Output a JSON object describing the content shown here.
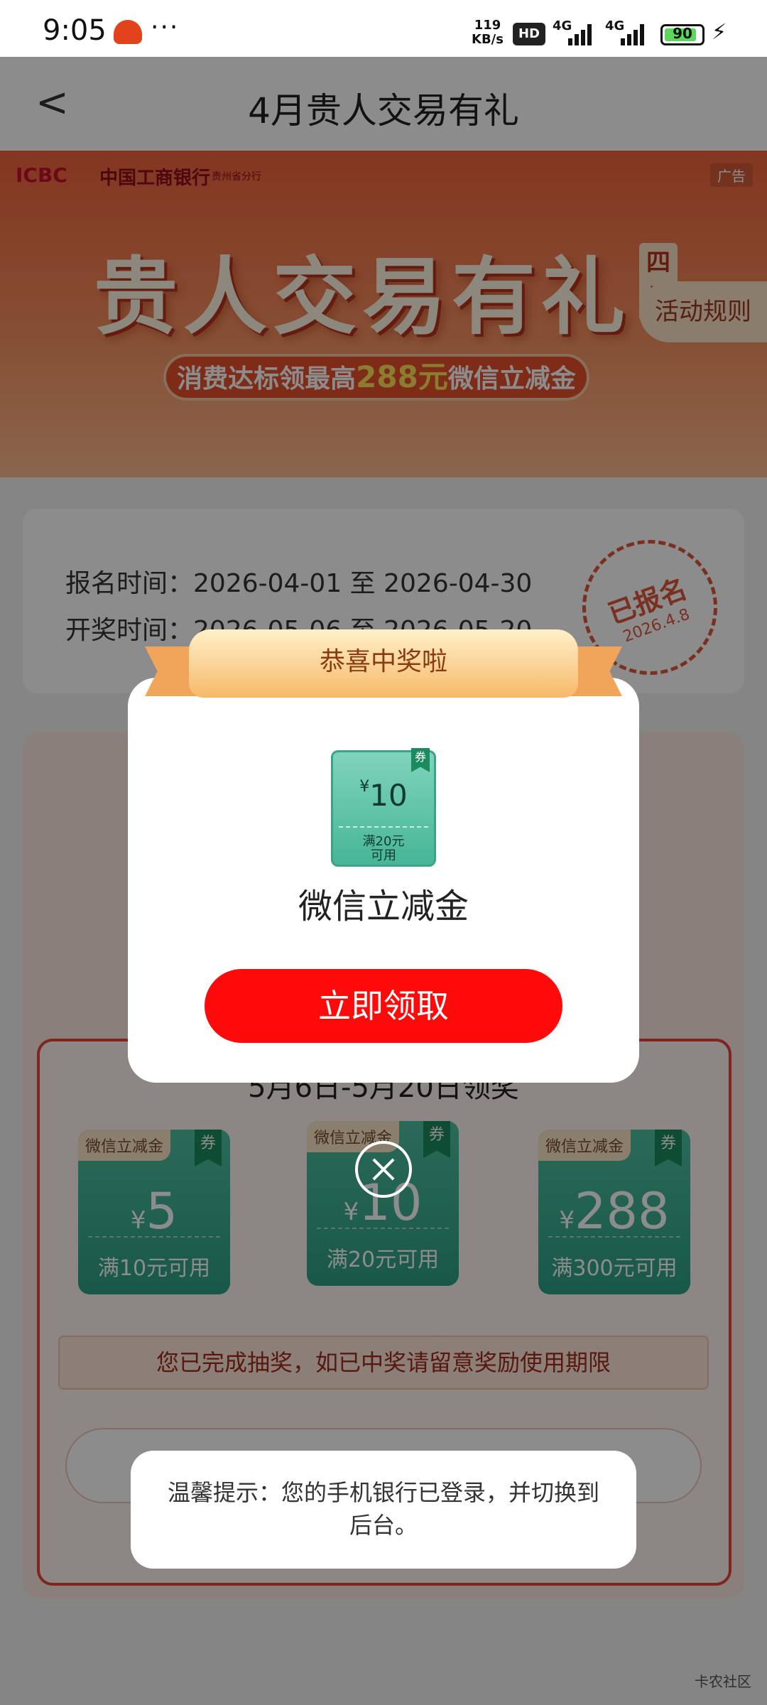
{
  "status_bar": {
    "time": "9:05",
    "more": "···",
    "speed_value": "119",
    "speed_unit": "KB/s",
    "hd": "HD",
    "network_1": "4G",
    "network_2": "4G",
    "battery": "90",
    "battery_level_percent": 90
  },
  "navbar": {
    "title": "4月贵人交易有礼"
  },
  "banner": {
    "logo": "ICBC",
    "bank_name": "中国工商银行",
    "branch": "贵州省分行",
    "ad_label": "广告",
    "title": "贵人交易有礼",
    "side_tag": "四月",
    "subtitle_prefix": "消费达标领最高",
    "subtitle_amount": "288元",
    "subtitle_suffix": "微信立减金",
    "rules_button": "活动规则"
  },
  "info": {
    "signup_label": "报名时间：",
    "signup_value": "2026-04-01 至 2026-04-30",
    "draw_label": "开奖时间：",
    "draw_value": "2026-05-06 至 2026-05-20",
    "stamp_text": "已报名",
    "stamp_date": "2026.4.8"
  },
  "prizes": {
    "period": "5月6日-5月20日领奖",
    "coupons": [
      {
        "label": "微信立减金",
        "flag": "券",
        "currency": "¥",
        "value": "5",
        "condition": "满10元可用"
      },
      {
        "label": "微信立减金",
        "flag": "券",
        "currency": "¥",
        "value": "10",
        "condition": "满20元可用"
      },
      {
        "label": "微信立减金",
        "flag": "券",
        "currency": "¥",
        "value": "288",
        "condition": "满300元可用"
      }
    ],
    "notice": "您已完成抽奖，如已中奖请留意奖励使用期限"
  },
  "modal": {
    "ribbon_title": "恭喜中奖啦",
    "ticket_flag": "券",
    "ticket_currency": "¥",
    "ticket_value": "10",
    "ticket_condition_1": "满20元",
    "ticket_condition_2": "可用",
    "prize_name": "微信立减金",
    "claim_button": "立即领取"
  },
  "toast": {
    "message": "温馨提示：您的手机银行已登录，并切换到后台。"
  },
  "watermark": "卡农社区"
}
